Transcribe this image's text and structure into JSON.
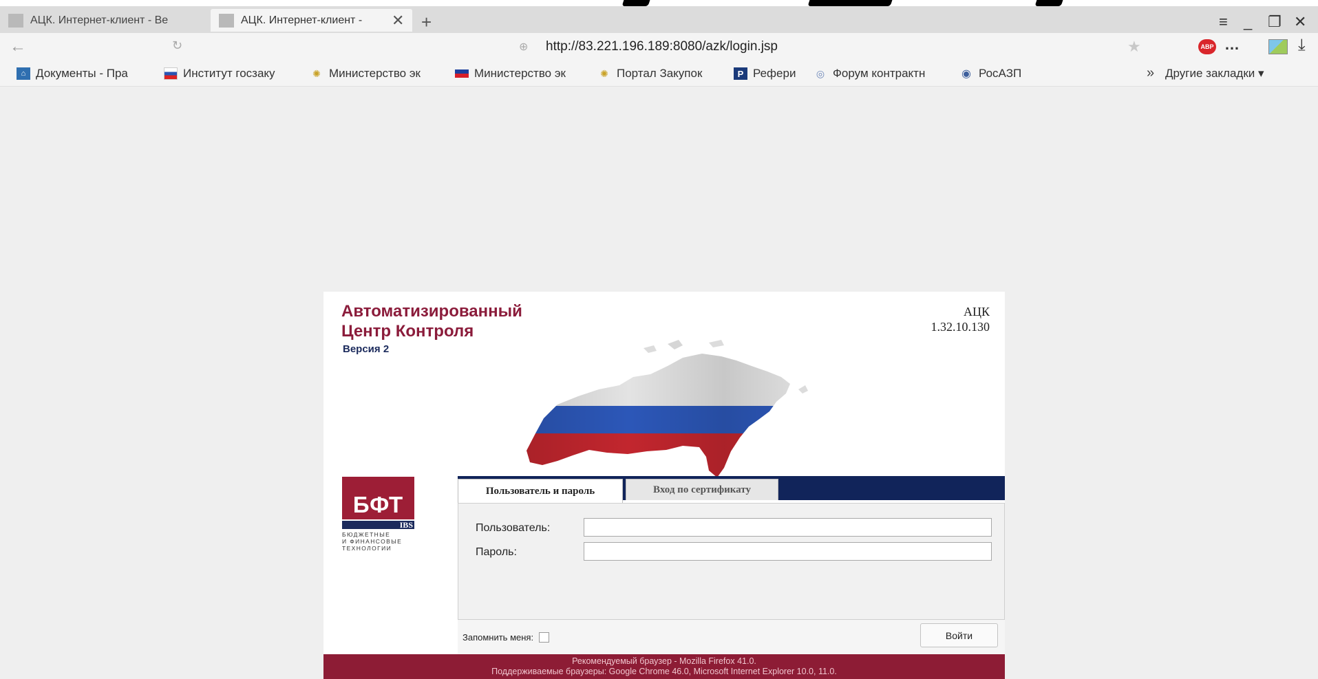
{
  "browser": {
    "tabs": [
      {
        "title": "АЦК. Интернет-клиент - Ве"
      },
      {
        "title": "АЦК. Интернет-клиент -"
      }
    ],
    "url": "http://83.221.196.189:8080/azk/login.jsp",
    "bookmarks": [
      {
        "label": "Документы - Пра",
        "icon": "building-icon"
      },
      {
        "label": "Институт госзаку",
        "icon": "russia-flag-icon"
      },
      {
        "label": "Министерство эк",
        "icon": "coat-of-arms-icon"
      },
      {
        "label": "Министерство эк",
        "icon": "flag-icon"
      },
      {
        "label": "Портал Закупок",
        "icon": "coat-of-arms-icon"
      },
      {
        "label": "Рефери",
        "icon": "p-logo-icon"
      },
      {
        "label": "Форум контрактн",
        "icon": "globe-icon"
      },
      {
        "label": "РосАЗП",
        "icon": "circle-logo-icon"
      }
    ],
    "other_bookmarks": "Другие закладки ▾",
    "abp_label": "ABP"
  },
  "login": {
    "brand_title_line1": "Автоматизированный",
    "brand_title_line2": "Центр Контроля",
    "version_label": "Версия 2",
    "app_name": "АЦК",
    "app_version": "1.32.10.130",
    "logo": {
      "main": "БФТ",
      "bar": "IBS",
      "line1": "БЮДЖЕТНЫЕ",
      "line2": "И ФИНАНСОВЫЕ",
      "line3": "ТЕХНОЛОГИИ"
    },
    "tab_user": "Пользователь и пароль",
    "tab_cert": "Вход по сертификату",
    "user_label": "Пользователь:",
    "user_value": "",
    "password_label": "Пароль:",
    "password_value": "",
    "remember_label": "Запомнить меня:",
    "submit_label": "Войти",
    "footer_line1": "Рекомендуемый браузер - Mozilla Firefox 41.0.",
    "footer_line2": "Поддерживаемые браузеры: Google Chrome 46.0, Microsoft Internet Explorer 10.0, 11.0."
  }
}
